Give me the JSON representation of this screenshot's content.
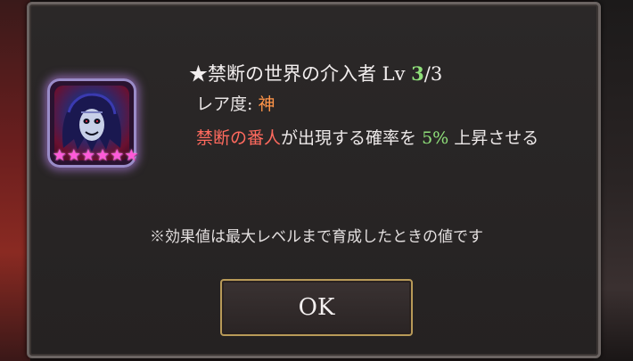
{
  "skill": {
    "title_prefix": "★禁断の世界の介入者 Lv ",
    "level_current": "3",
    "level_max": "/3",
    "rarity_label": "レア度: ",
    "rarity_value": "神",
    "desc_red": "禁断の番人",
    "desc_mid": "が出現する確率を ",
    "desc_green": "5%",
    "desc_end": " 上昇させる",
    "icon_name": "forbidden-guardian-portrait-icon",
    "stars": [
      "★",
      "★",
      "★",
      "★",
      "★",
      "★"
    ]
  },
  "note": "※効果値は最大レベルまで育成したときの値です",
  "ok_button": "OK",
  "colors": {
    "level_current": "#8fe07a",
    "rarity_value": "#ff9448",
    "highlight_red": "#ff6a5e",
    "highlight_green": "#8fe07a",
    "button_border": "#b89a58"
  }
}
